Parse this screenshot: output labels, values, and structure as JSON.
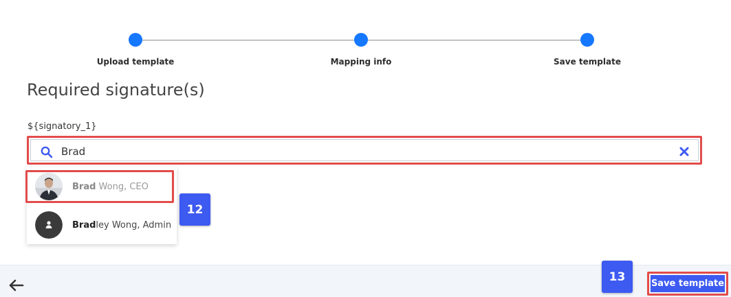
{
  "stepper": {
    "steps": [
      {
        "label": "Upload template"
      },
      {
        "label": "Mapping info"
      },
      {
        "label": "Save template"
      }
    ],
    "active_color": "#1677ff"
  },
  "page_title": "Required signature(s)",
  "field": {
    "label": "${signatory_1}",
    "value": "Brad",
    "search_icon": "search-icon",
    "clear_icon": "close-icon"
  },
  "suggestions": [
    {
      "match": "Brad",
      "rest": " Wong, CEO",
      "avatar": "photo"
    },
    {
      "match": "Brad",
      "rest": "ley Wong, Admin",
      "avatar": "default-user-icon"
    }
  ],
  "callouts": {
    "first": "12",
    "second": "13"
  },
  "footer": {
    "back_icon": "arrow-left-icon",
    "save_label": "Save template"
  },
  "colors": {
    "accent": "#3d5af1",
    "highlight": "#e24b4b",
    "step": "#1677ff"
  }
}
